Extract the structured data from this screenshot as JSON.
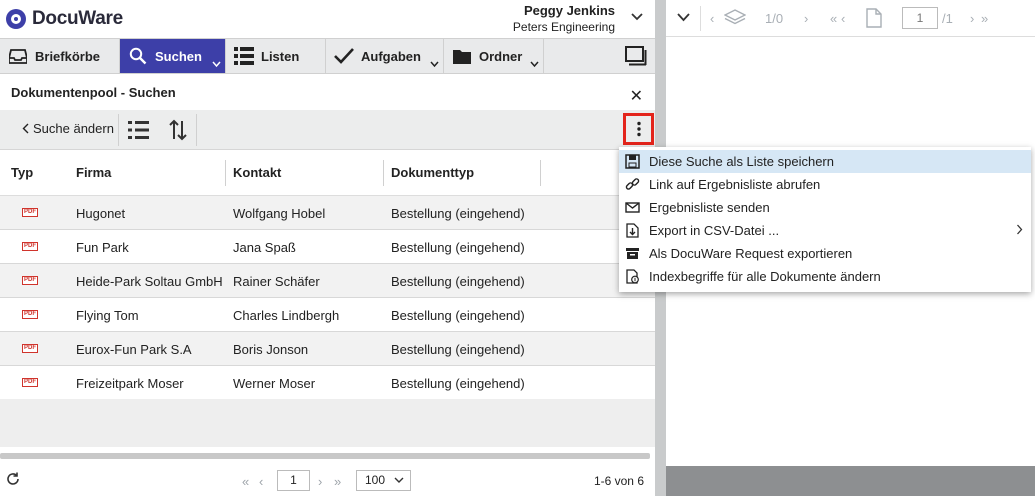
{
  "app": {
    "logo_text": "DocuWare",
    "user_name": "Peggy Jenkins",
    "company": "Peters Engineering"
  },
  "nav": {
    "tabs": [
      {
        "label": "Briefkörbe",
        "icon": "tray-icon"
      },
      {
        "label": "Suchen",
        "icon": "search-icon"
      },
      {
        "label": "Listen",
        "icon": "list-icon"
      },
      {
        "label": "Aufgaben",
        "icon": "check-icon"
      },
      {
        "label": "Ordner",
        "icon": "folder-icon"
      }
    ]
  },
  "panel": {
    "title": "Dokumentenpool - Suchen",
    "close_glyph": "✕"
  },
  "toolbar": {
    "back_label": "Suche ändern"
  },
  "table": {
    "columns": [
      "Typ",
      "Firma",
      "Kontakt",
      "Dokumenttyp"
    ],
    "rows": [
      {
        "type": "PDF",
        "firma": "Hugonet",
        "kontakt": "Wolfgang Hobel",
        "dokumenttyp": "Bestellung (eingehend)"
      },
      {
        "type": "PDF",
        "firma": "Fun Park",
        "kontakt": "Jana Spaß",
        "dokumenttyp": "Bestellung (eingehend)"
      },
      {
        "type": "PDF",
        "firma": "Heide-Park Soltau GmbH",
        "kontakt": "Rainer Schäfer",
        "dokumenttyp": "Bestellung (eingehend)"
      },
      {
        "type": "PDF",
        "firma": "Flying Tom",
        "kontakt": "Charles Lindbergh",
        "dokumenttyp": "Bestellung (eingehend)"
      },
      {
        "type": "PDF",
        "firma": "Eurox-Fun Park S.A",
        "kontakt": "Boris Jonson",
        "dokumenttyp": "Bestellung (eingehend)"
      },
      {
        "type": "PDF",
        "firma": "Freizeitpark Moser",
        "kontakt": "Werner Moser",
        "dokumenttyp": "Bestellung (eingehend)"
      }
    ]
  },
  "pagination": {
    "first": "«",
    "prev": "‹",
    "page": "1",
    "next": "›",
    "last": "»",
    "page_size": "100",
    "count_text": "1-6 von 6"
  },
  "viewer": {
    "layer_count": "1/0",
    "page_input": "1",
    "page_total": "/1"
  },
  "menu": {
    "items": [
      {
        "label": "Diese Suche als Liste speichern",
        "icon": "save-icon",
        "highlighted": true
      },
      {
        "label": "Link auf Ergebnisliste abrufen",
        "icon": "link-icon"
      },
      {
        "label": "Ergebnisliste senden",
        "icon": "mail-icon"
      },
      {
        "label": "Export in CSV-Datei ...",
        "icon": "export-icon",
        "submenu": true
      },
      {
        "label": "Als DocuWare Request exportieren",
        "icon": "request-icon"
      },
      {
        "label": "Indexbegriffe für alle Dokumente ändern",
        "icon": "edit-index-icon"
      }
    ]
  },
  "colors": {
    "accent": "#3d3fa8",
    "highlight_border": "#e3241b",
    "menu_hover": "#d6e7f5"
  }
}
